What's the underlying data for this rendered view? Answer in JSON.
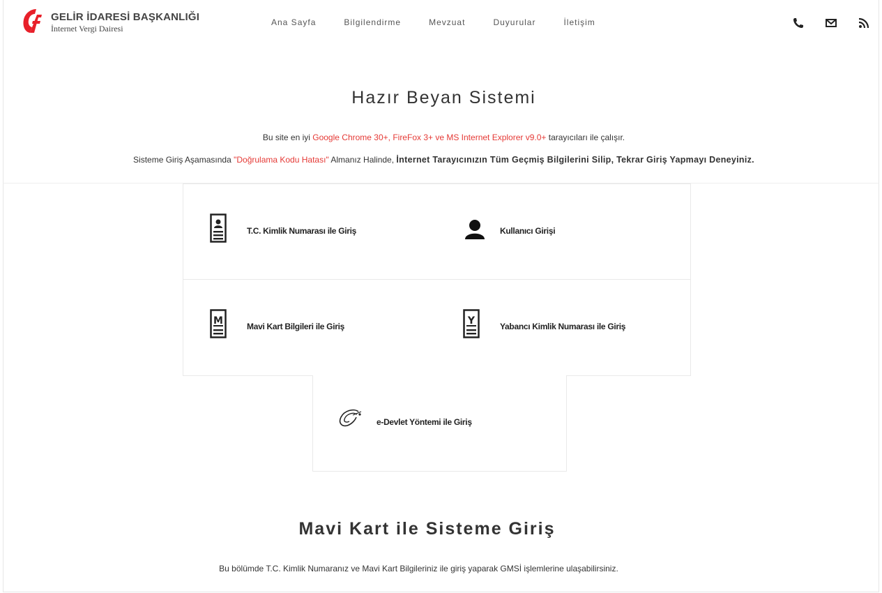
{
  "brand": {
    "title": "GELİR İDARESİ BAŞKANLIĞI",
    "subtitle": "İnternet Vergi Dairesi",
    "logo_icon": "gib-logo-icon",
    "accent": "#e8202a"
  },
  "nav": [
    {
      "label": "Ana Sayfa"
    },
    {
      "label": "Bilgilendirme"
    },
    {
      "label": "Mevzuat"
    },
    {
      "label": "Duyurular"
    },
    {
      "label": "İletişim"
    }
  ],
  "header_icons": [
    "phone-icon",
    "mail-icon",
    "rss-icon"
  ],
  "main": {
    "title": "Hazır Beyan Sistemi",
    "info1_pre": "Bu site en iyi ",
    "info1_red": "Google Chrome 30+, FireFox 3+ ve MS Internet Explorer v9.0+",
    "info1_post": " tarayıcıları ile çalışır.",
    "info2_pre": "Sisteme Giriş Aşamasında ",
    "info2_red": "\"Doğrulama Kodu Hatası\"",
    "info2_mid": " Almanız Halinde, ",
    "info2_bold": "İnternet Tarayıcınızın Tüm Geçmiş Bilgilerini Silip, Tekrar Giriş Yapmayı Deneyiniz."
  },
  "login_options": [
    {
      "label": "T.C. Kimlik Numarası ile Giriş",
      "icon": "id-card-icon"
    },
    {
      "label": "Kullanıcı Girişi",
      "icon": "user-icon"
    },
    {
      "label": "Mavi Kart Bilgileri ile Giriş",
      "icon": "mavi-kart-icon"
    },
    {
      "label": "Yabancı Kimlik Numarası ile Giriş",
      "icon": "yabanci-kimlik-icon"
    },
    {
      "label": "e-Devlet Yöntemi ile Giriş",
      "icon": "e-devlet-icon"
    }
  ],
  "section": {
    "title": "Mavi Kart ile Sisteme Giriş",
    "description": "Bu bölümde T.C. Kimlik Numaranız ve Mavi Kart Bilgileriniz ile giriş yaparak GMSİ işlemlerine ulaşabilirsiniz."
  }
}
